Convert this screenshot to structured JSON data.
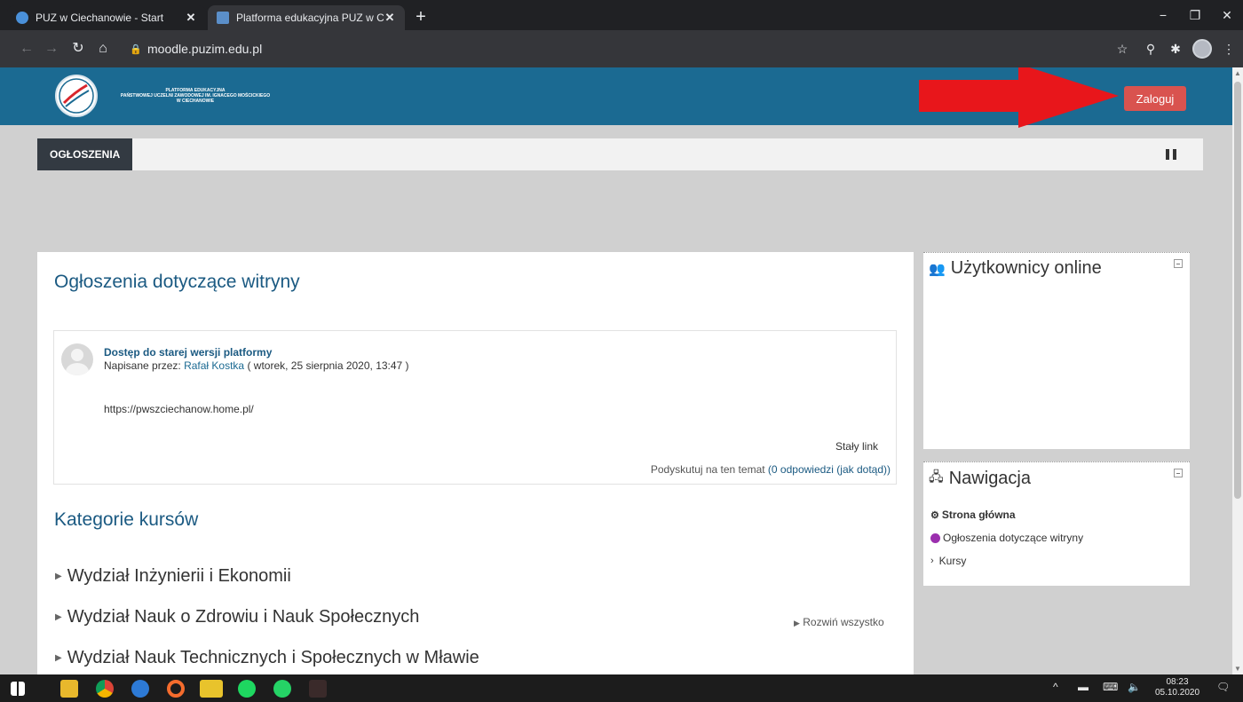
{
  "browser": {
    "tabs": [
      {
        "title": "PUZ w Ciechanowie - Start",
        "close": "✕"
      },
      {
        "title": "Platforma edukacyjna PUZ w Cie",
        "close": "✕"
      }
    ],
    "new_tab": "+",
    "url": "moodle.puzim.edu.pl"
  },
  "header": {
    "logo_text_lines": [
      "PLATFORMA EDUKACYJNA",
      "PAŃSTWOWEJ UCZELNI ZAWODOWEJ IM. IGNACEGO MOŚCICKIEGO",
      "W CIECHANOWIE"
    ],
    "login_label": "Zaloguj",
    "arrow_color": "#e8161b"
  },
  "menu": {
    "item": "OGŁOSZENIA"
  },
  "announcements": {
    "title": "Ogłoszenia dotyczące witryny",
    "post": {
      "subject": "Dostęp do starej wersji platformy",
      "written_by": "Napisane przez:",
      "author": "Rafał Kostka",
      "date": "( wtorek, 25 sierpnia 2020, 13:47 )",
      "body": "https://pwszciechanow.home.pl/",
      "permalink": "Stały link",
      "discuss": "Podyskutuj na ten temat",
      "replies": "(0 odpowiedzi (jak dotąd))"
    }
  },
  "categories": {
    "title": "Kategorie kursów",
    "expand_all": "Rozwiń wszystko",
    "items": [
      "Wydział Inżynierii i Ekonomii",
      "Wydział Nauk o Zdrowiu i Nauk Społecznych",
      "Wydział Nauk Technicznych i Społecznych w Mławie"
    ]
  },
  "blocks": {
    "online_users": {
      "title": "Użytkownicy online"
    },
    "navigation": {
      "title": "Nawigacja",
      "items": [
        "Strona główna",
        "Ogłoszenia dotyczące witryny",
        "Kursy"
      ]
    }
  },
  "taskbar": {
    "time": "08:23",
    "date": "05.10.2020"
  },
  "colors": {
    "header_bg": "#1b6a92",
    "login_bg": "#d9534f",
    "link": "#1b5a82"
  }
}
